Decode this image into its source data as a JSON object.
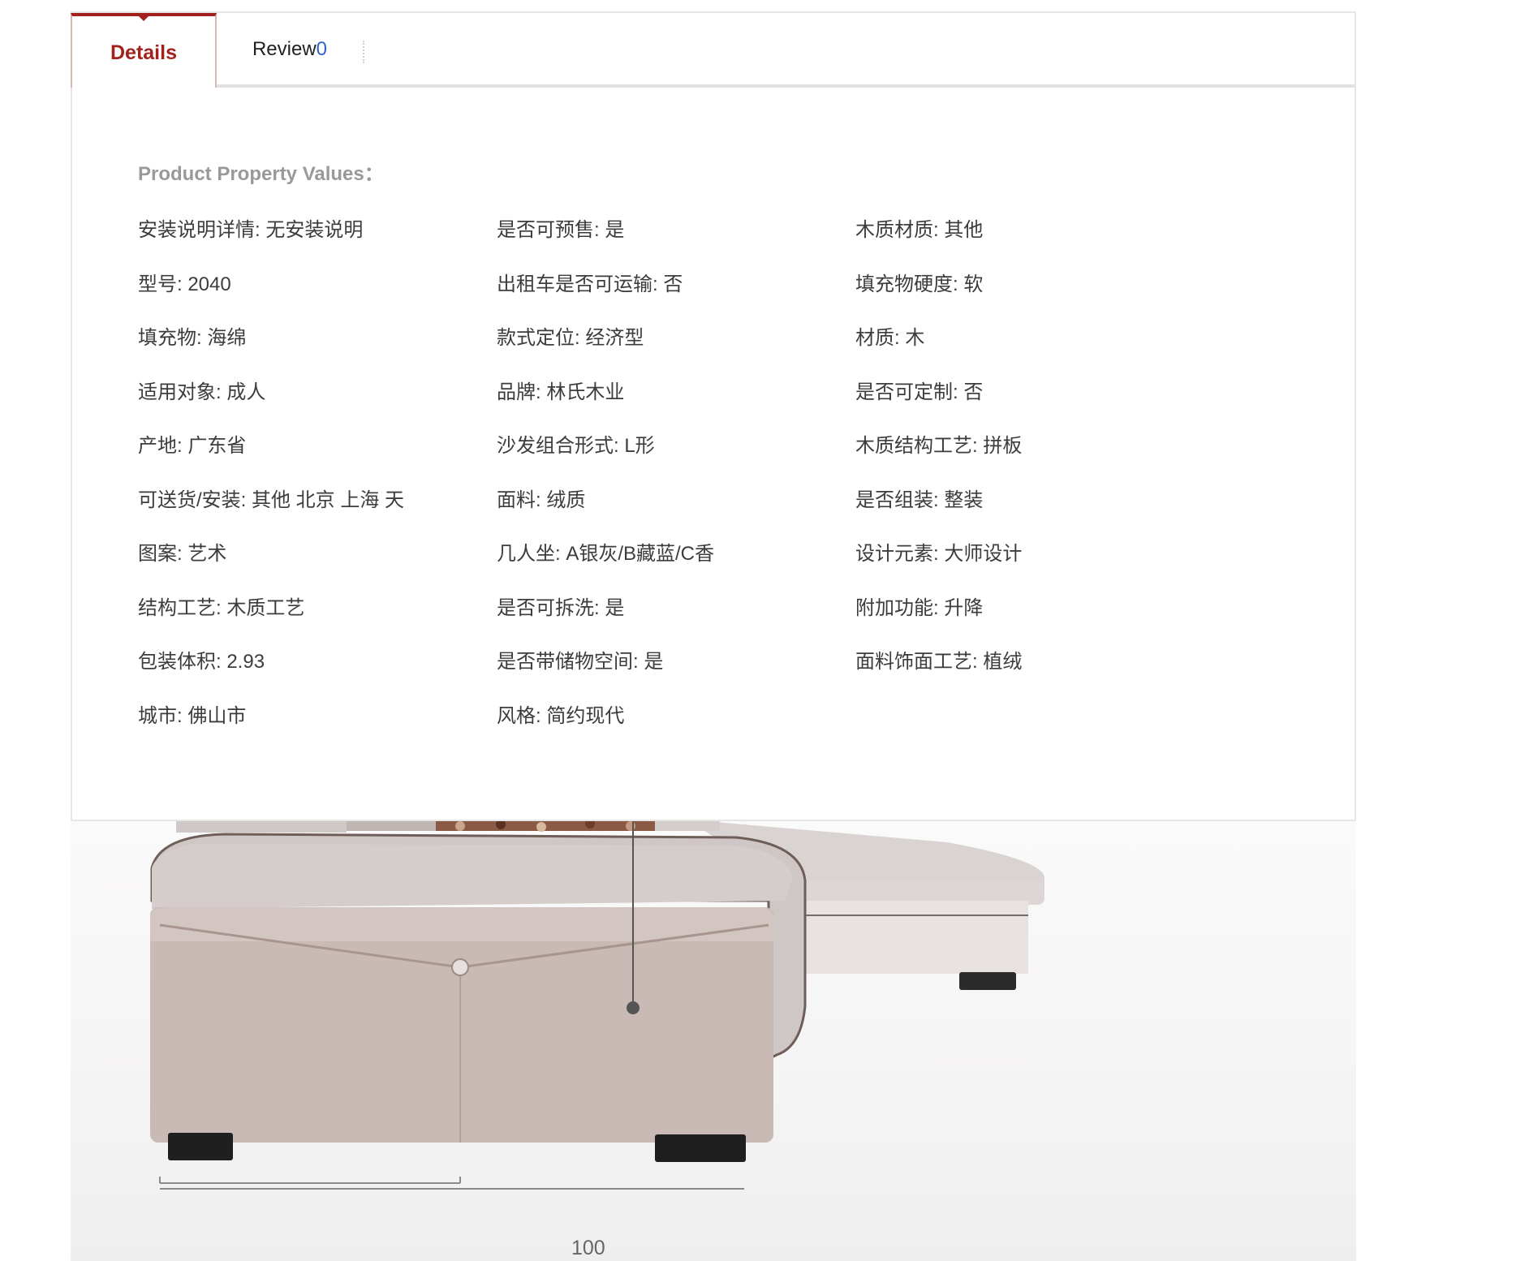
{
  "tabs": {
    "details_label": "Details",
    "review_label": "Review",
    "review_count": "0"
  },
  "details": {
    "heading": "Product Property Values：",
    "properties": [
      "安装说明详情: 无安装说明",
      "是否可预售: 是",
      "木质材质: 其他",
      "型号: 2040",
      "出租车是否可运输: 否",
      "填充物硬度: 软",
      "填充物: 海绵",
      "款式定位: 经济型",
      "材质: 木",
      "适用对象: 成人",
      "品牌: 林氏木业",
      "是否可定制: 否",
      "产地: 广东省",
      "沙发组合形式: L形",
      "木质结构工艺: 拼板",
      "可送货/安装: 其他 北京 上海 天",
      "面料: 绒质",
      "是否组装: 整装",
      "图案: 艺术",
      "几人坐: A银灰/B藏蓝/C香",
      "设计元素: 大师设计",
      "结构工艺: 木质工艺",
      "是否可拆洗: 是",
      "附加功能: 升降",
      "包装体积: 2.93",
      "是否带储物空间: 是",
      "面料饰面工艺: 植绒",
      "城市: 佛山市",
      "风格: 简约现代"
    ]
  },
  "product_image": {
    "dimension_label": "100"
  },
  "colors": {
    "accent": "#a3211c",
    "link": "#2d63c8",
    "heading_gray": "#999999",
    "text": "#3c3c3c"
  }
}
